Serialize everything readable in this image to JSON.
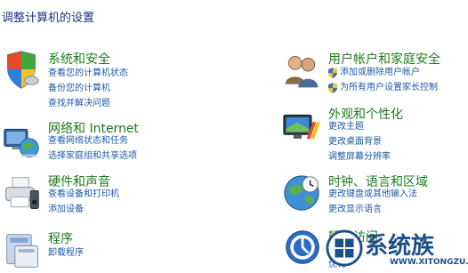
{
  "page_title": "调整计算机的设置",
  "categories": {
    "system": {
      "title": "系统和安全",
      "links": [
        "查看您的计算机状态",
        "备份您的计算机",
        "查找并解决问题"
      ]
    },
    "network": {
      "title": "网络和 Internet",
      "links": [
        "查看网络状态和任务",
        "选择家庭组和共享选项"
      ]
    },
    "hardware": {
      "title": "硬件和声音",
      "links": [
        "查看设备和打印机",
        "添加设备"
      ]
    },
    "programs": {
      "title": "程序",
      "links": [
        "卸载程序"
      ]
    },
    "users": {
      "title": "用户帐户和家庭安全",
      "links": [
        "添加或删除用户帐户",
        "为所有用户设置家长控制"
      ]
    },
    "appearance": {
      "title": "外观和个性化",
      "links": [
        "更改主题",
        "更改桌面背景",
        "调整屏幕分辨率"
      ]
    },
    "clock": {
      "title": "时钟、语言和区域",
      "links": [
        "更改键盘或其他输入法",
        "更改显示语言"
      ]
    },
    "ease": {
      "title": "轻松访问",
      "links": [
        "使",
        "优化"
      ]
    }
  },
  "watermark": {
    "text": "系统族",
    "url": "WWW.XITONGZU.COM"
  },
  "colors": {
    "title": "#1e3287",
    "category_title": "#1e7a1e",
    "link": "#1e5aa8"
  }
}
